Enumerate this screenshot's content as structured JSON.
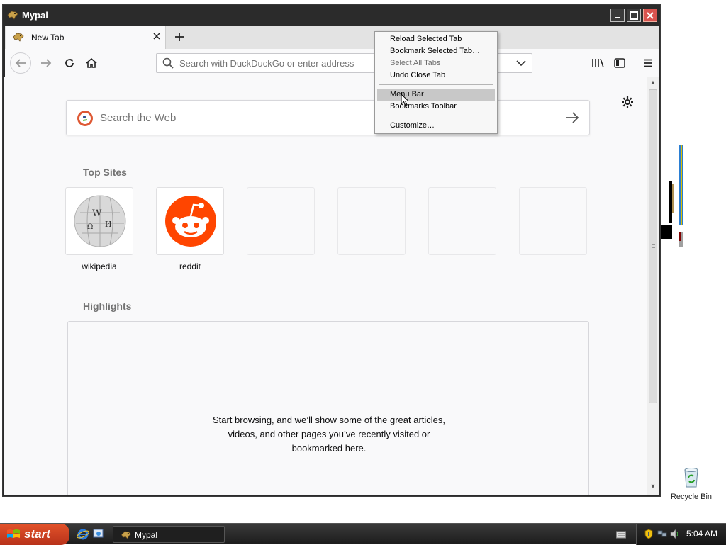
{
  "window": {
    "title": "Mypal"
  },
  "tabs": [
    {
      "label": "New Tab"
    }
  ],
  "urlbar": {
    "placeholder": "Search with DuckDuckGo or enter address"
  },
  "newtab": {
    "search_placeholder": "Search the Web",
    "top_sites_title": "Top Sites",
    "top_sites": [
      {
        "label": "wikipedia"
      },
      {
        "label": "reddit"
      }
    ],
    "highlights_title": "Highlights",
    "highlights_message": [
      "Start browsing, and we’ll show some of the great articles,",
      "videos, and other pages you’ve recently visited or",
      "bookmarked here."
    ]
  },
  "context_menu": {
    "items": [
      {
        "label": "Reload Selected Tab",
        "disabled": false
      },
      {
        "label": "Bookmark Selected Tab…",
        "disabled": false
      },
      {
        "label": "Select All Tabs",
        "disabled": true
      },
      {
        "label": "Undo Close Tab",
        "disabled": false
      },
      {
        "label": "Menu Bar",
        "highlighted": true
      },
      {
        "label": "Bookmarks Toolbar",
        "disabled": false
      },
      {
        "label": "Customize…",
        "disabled": false
      }
    ]
  },
  "desktop": {
    "recycle_bin_label": "Recycle Bin"
  },
  "taskbar": {
    "start_label": "start",
    "task_label": "Mypal",
    "clock": "5:04 AM"
  },
  "colors": {
    "reddit": "#ff4500",
    "start": "#d8442a",
    "menu_highlight": "#c8c8c8"
  }
}
